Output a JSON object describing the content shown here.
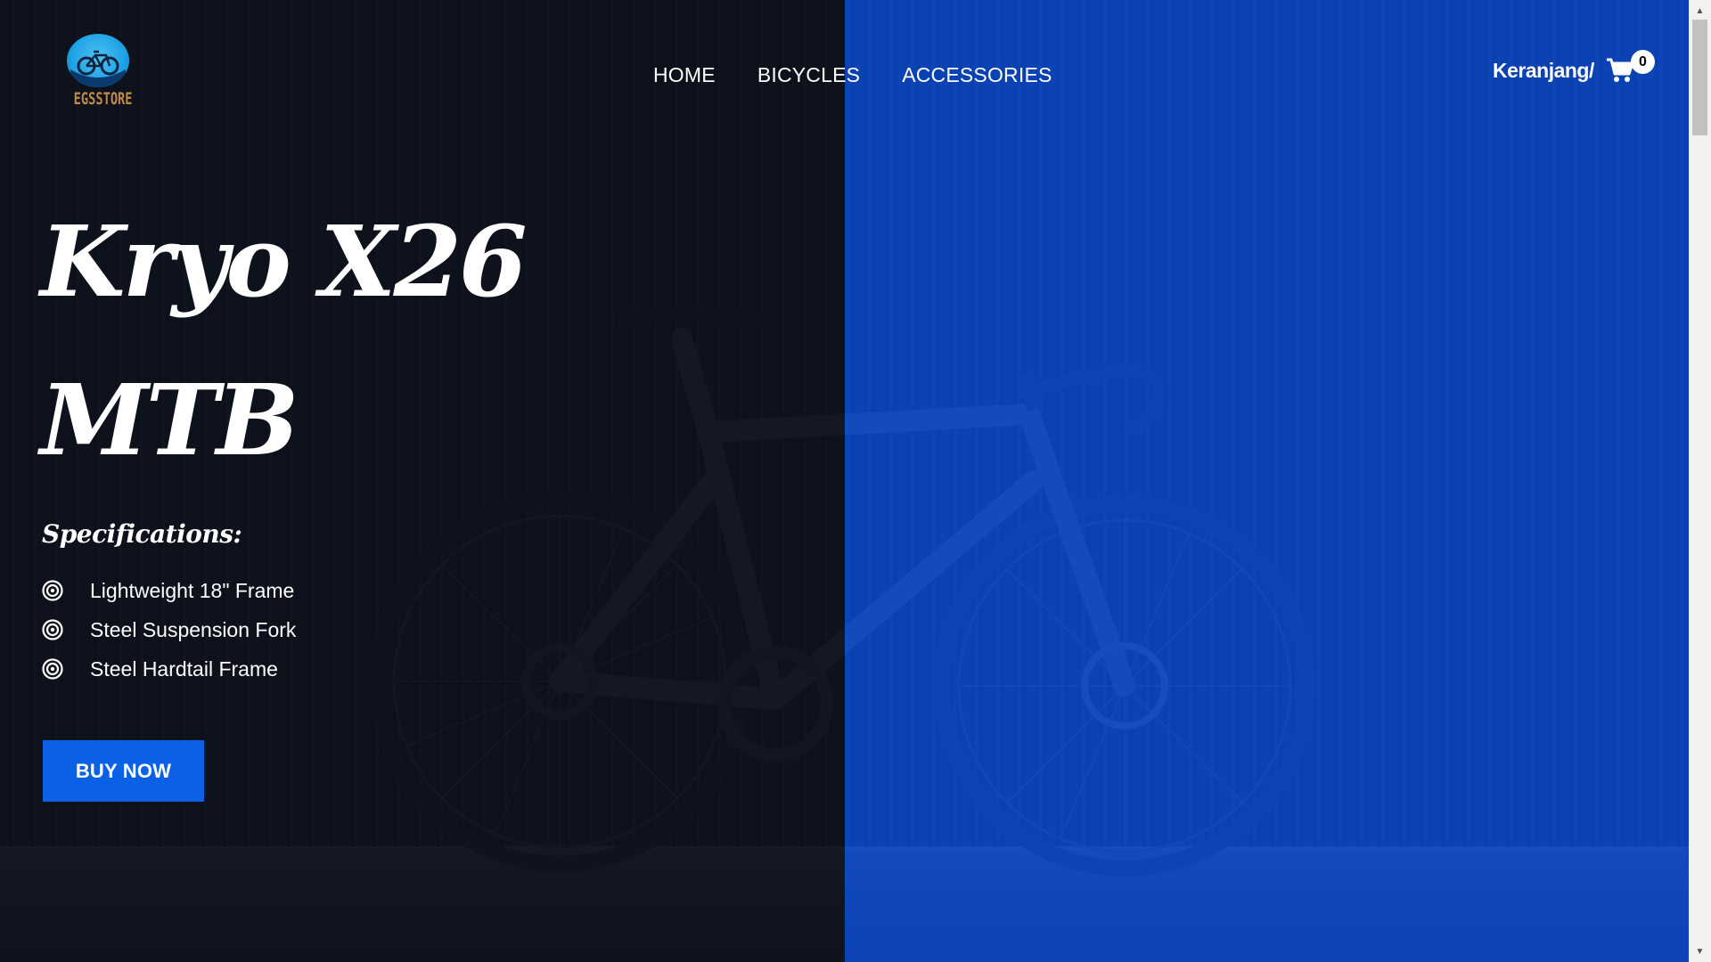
{
  "brand": {
    "logo_text": "EGSSTORE",
    "logo_icon": "bicycle-logo-icon",
    "logo_color": "#c08a46",
    "logo_circle_color": "#1fa3e6"
  },
  "nav": {
    "items": [
      {
        "label": "HOME"
      },
      {
        "label": "BICYCLES"
      },
      {
        "label": "ACCESSORIES"
      }
    ]
  },
  "cart": {
    "label": "Keranjang/",
    "icon": "shopping-cart-icon",
    "count": "0"
  },
  "hero": {
    "title_line1": "Kryo X26",
    "title_line2": "MTB",
    "spec_heading": "Specifications:",
    "specs": [
      {
        "label": "Lightweight 18\" Frame",
        "icon": "target-bullet-icon"
      },
      {
        "label": "Steel Suspension Fork",
        "icon": "target-bullet-icon"
      },
      {
        "label": "Steel Hardtail Frame",
        "icon": "target-bullet-icon"
      }
    ],
    "cta_label": "BUY NOW",
    "cta_color": "#0a61e6",
    "background": "bicycle-photo-against-corrugated-wall"
  },
  "colors": {
    "dark_overlay": "#090e1a",
    "blue_overlay": "#0548d6",
    "text": "#ffffff"
  }
}
